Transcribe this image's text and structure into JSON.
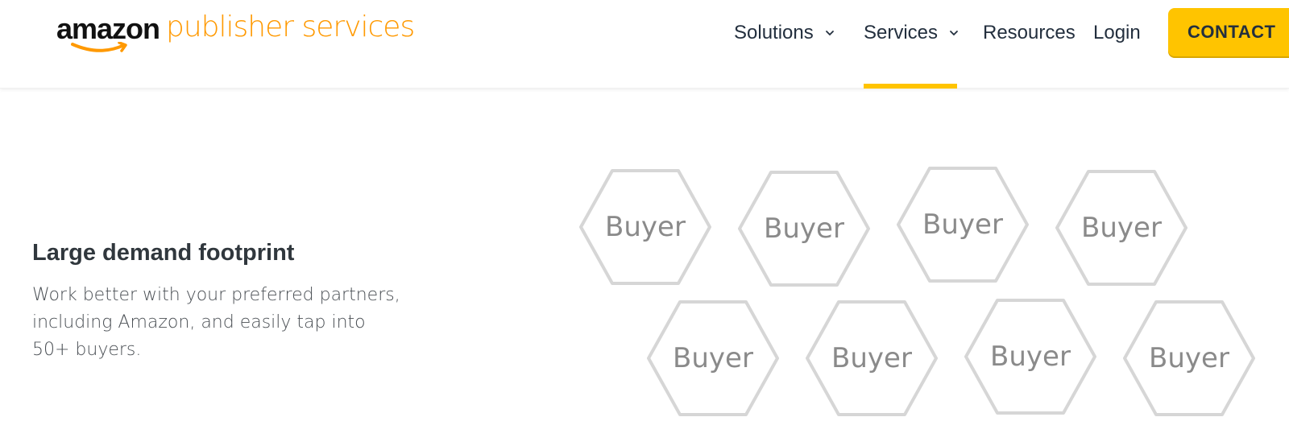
{
  "header": {
    "logo": {
      "brand": "amazon",
      "product": "publisher services",
      "brand_color": "#111111",
      "accent_color": "#ff9900"
    },
    "nav": [
      {
        "label": "Solutions",
        "has_dropdown": true,
        "active": false
      },
      {
        "label": "Services",
        "has_dropdown": true,
        "active": true
      },
      {
        "label": "Resources",
        "has_dropdown": false,
        "active": false
      },
      {
        "label": "Login",
        "has_dropdown": false,
        "active": false
      }
    ],
    "contact_button": {
      "label": "CONTACT"
    },
    "active_color": "#ffc400"
  },
  "feature": {
    "title": "Large demand footprint",
    "description": "Work better with your preferred partners, including Amazon, and easily tap into 50+ buyers."
  },
  "buyers": {
    "label": "Buyer",
    "rows": [
      [
        "Buyer",
        "Buyer",
        "Buyer",
        "Buyer"
      ],
      [
        "Buyer",
        "Buyer",
        "Buyer",
        "Buyer"
      ]
    ]
  }
}
